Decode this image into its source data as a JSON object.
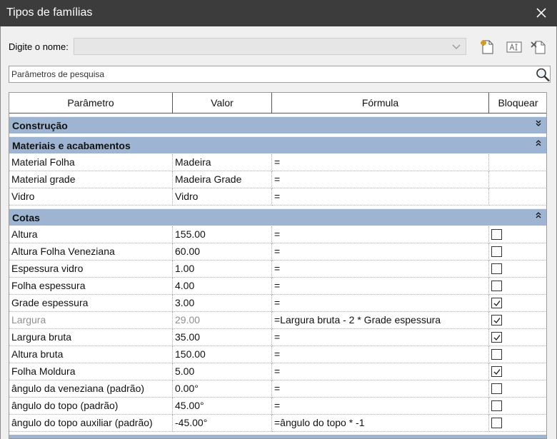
{
  "window": {
    "title": "Tipos de famílias"
  },
  "toolbar": {
    "name_label": "Digite o nome:",
    "name_value": "",
    "new_type_icon": "new-type-icon",
    "rename_icon": "rename-type-icon",
    "delete_icon": "delete-type-icon"
  },
  "search": {
    "placeholder": "Parâmetros de pesquisa",
    "value": ""
  },
  "table": {
    "headers": {
      "param": "Parâmetro",
      "valor": "Valor",
      "formula": "Fórmula",
      "bloquear": "Bloquear"
    },
    "groups": {
      "construcao": "Construção",
      "materiais": "Materiais e acabamentos",
      "cotas": "Cotas"
    },
    "materiais_rows": [
      {
        "param": "Material Folha",
        "valor": "Madeira",
        "formula": "="
      },
      {
        "param": "Material grade",
        "valor": "Madeira Grade",
        "formula": "="
      },
      {
        "param": "Vidro",
        "valor": "Vidro",
        "formula": "="
      }
    ],
    "cotas_rows": [
      {
        "param": "Altura",
        "valor": "155.00",
        "formula": "=",
        "locked": false
      },
      {
        "param": "Altura Folha Veneziana",
        "valor": "60.00",
        "formula": "=",
        "locked": false
      },
      {
        "param": "Espessura vidro",
        "valor": "1.00",
        "formula": "=",
        "locked": false
      },
      {
        "param": "Folha espessura",
        "valor": "4.00",
        "formula": "=",
        "locked": false
      },
      {
        "param": "Grade espessura",
        "valor": "3.00",
        "formula": "=",
        "locked": true
      },
      {
        "param": "Largura",
        "valor": "29.00",
        "formula": "=Largura bruta - 2 * Grade espessura",
        "locked": true,
        "readonly": true
      },
      {
        "param": "Largura bruta",
        "valor": "35.00",
        "formula": "=",
        "locked": true
      },
      {
        "param": "Altura bruta",
        "valor": "150.00",
        "formula": "=",
        "locked": false
      },
      {
        "param": "Folha Moldura",
        "valor": "5.00",
        "formula": "=",
        "locked": true
      },
      {
        "param": "ângulo da veneziana (padrão)",
        "valor": "0.00°",
        "formula": "=",
        "locked": false
      },
      {
        "param": "ângulo do topo (padrão)",
        "valor": "45.00°",
        "formula": "=",
        "locked": false
      },
      {
        "param": "ângulo do topo auxiliar (padrão)",
        "valor": "-45.00°",
        "formula": "=ângulo do topo * -1",
        "locked": false
      }
    ]
  },
  "colors": {
    "group_band": "#9db5d2",
    "titlebar": "#3c3c3c",
    "dialog_bg": "#f0f0f0"
  }
}
